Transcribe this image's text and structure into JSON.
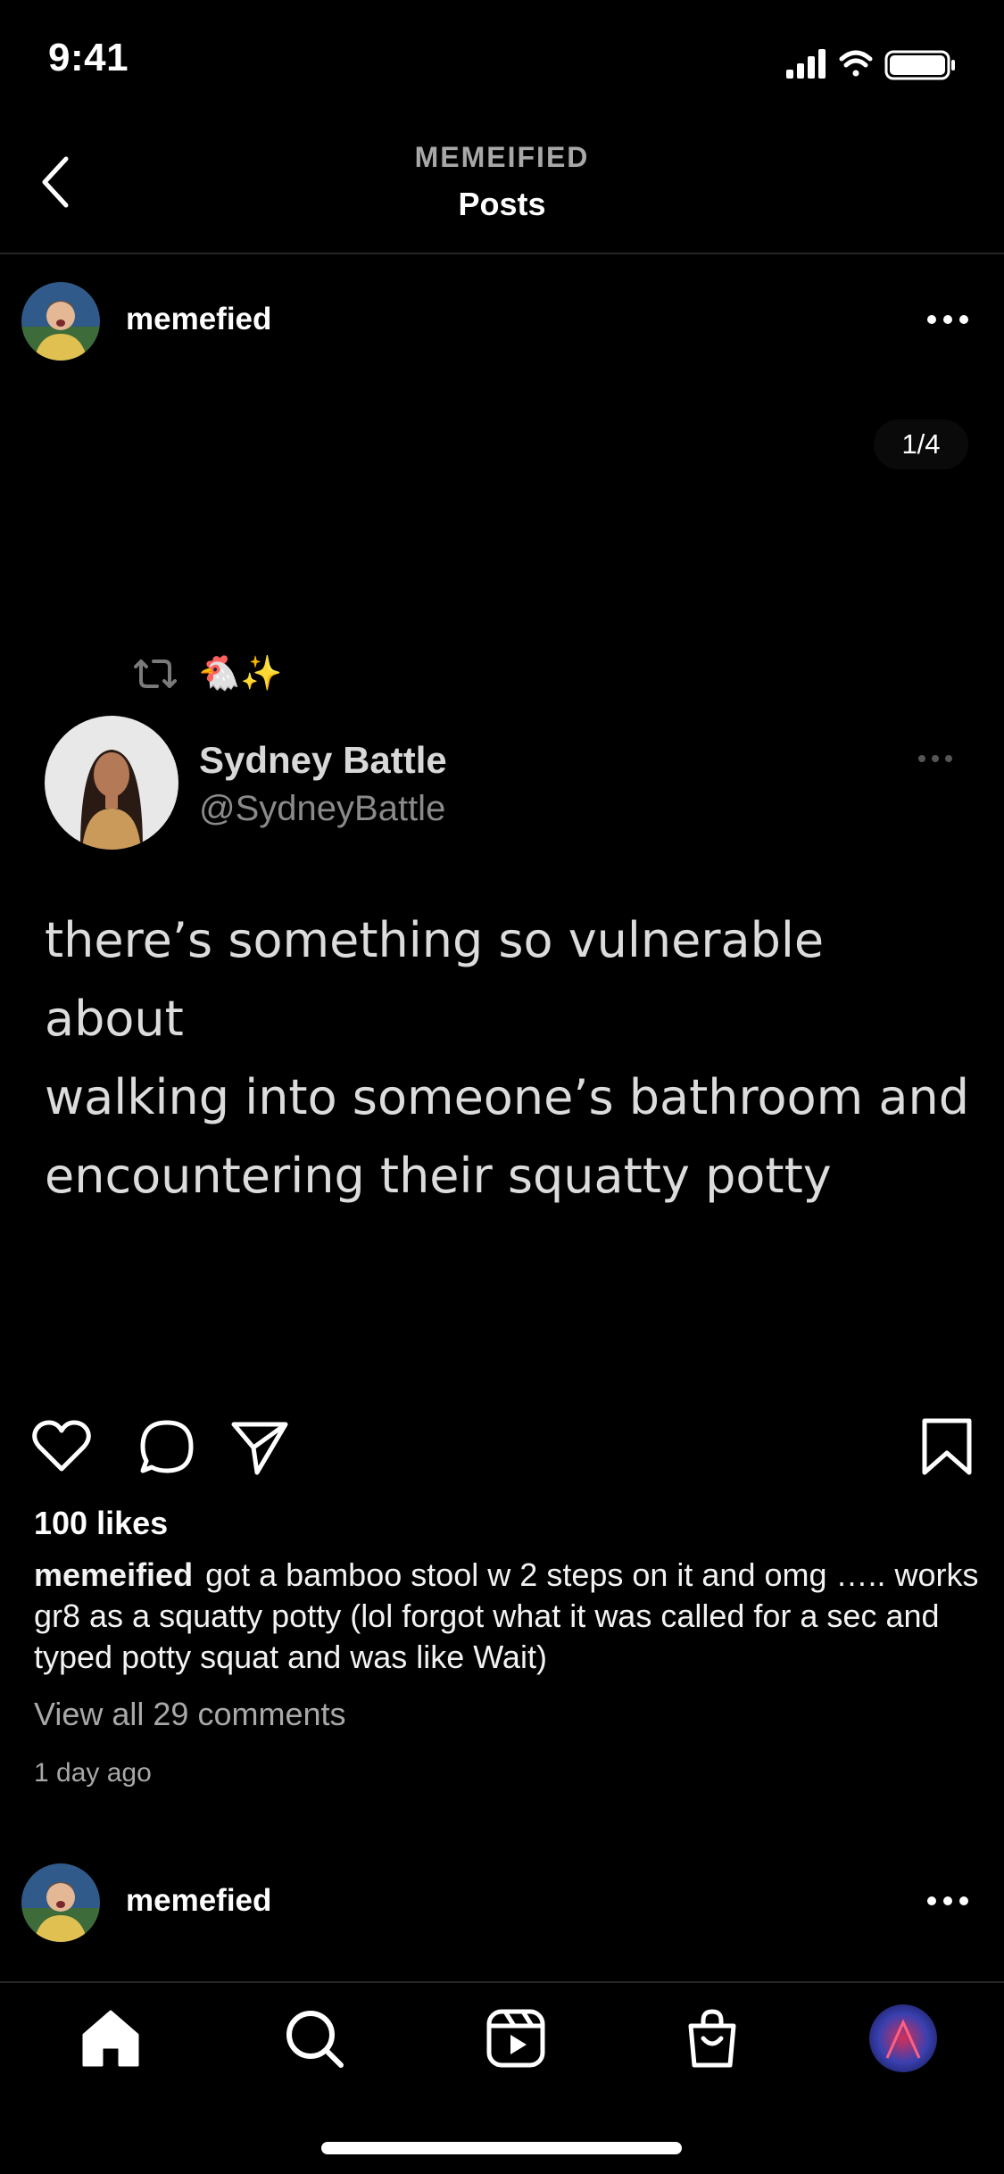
{
  "status_bar": {
    "time": "9:41"
  },
  "header": {
    "account": "MEMEIFIED",
    "title": "Posts"
  },
  "post": {
    "username": "memefied",
    "image_counter": "1/4",
    "tweet": {
      "emojis": "🐔✨",
      "name": "Sydney Battle",
      "handle": "@SydneyBattle",
      "text_lines": [
        "there’s something so vulnerable about",
        "walking into someone’s bathroom and",
        "encountering their squatty potty"
      ]
    },
    "likes": "100 likes",
    "caption_user": "memeified",
    "caption_text": "got a bamboo stool w 2 steps on it and omg ….. works gr8 as a squatty potty (lol forgot what it was called for a sec and typed potty squat and was like Wait)",
    "view_comments": "View all 29 comments",
    "time_ago": "1 day ago"
  },
  "next_post": {
    "username": "memefied"
  },
  "colors": {
    "background": "#000000",
    "secondary_text": "#a8a8a8",
    "divider": "#262626"
  },
  "icons": [
    "back-chevron-icon",
    "signal-icon",
    "wifi-icon",
    "battery-icon",
    "more-icon",
    "retweet-icon",
    "heart-icon",
    "comment-icon",
    "share-icon",
    "bookmark-icon",
    "home-icon",
    "search-icon",
    "reels-icon",
    "shop-icon",
    "profile-avatar-icon"
  ]
}
